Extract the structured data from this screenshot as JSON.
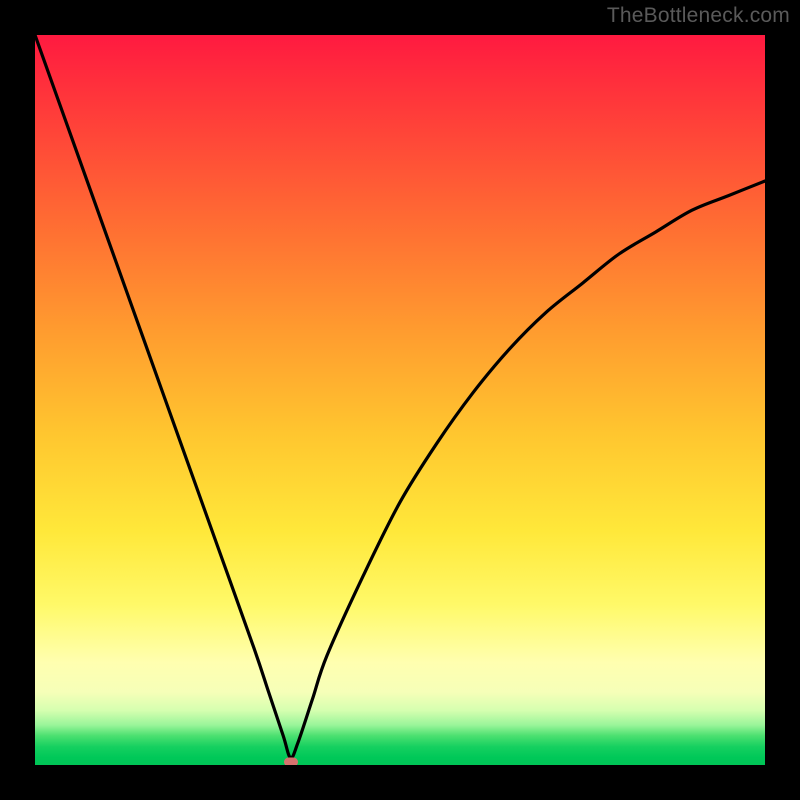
{
  "watermark": "TheBottleneck.com",
  "chart_data": {
    "type": "line",
    "title": "",
    "xlabel": "",
    "ylabel": "",
    "xlim": [
      0,
      100
    ],
    "ylim": [
      0,
      100
    ],
    "grid": false,
    "legend": false,
    "background": "red-yellow-green vertical gradient",
    "series": [
      {
        "name": "bottleneck-curve",
        "color": "#000000",
        "x": [
          0,
          5,
          10,
          15,
          20,
          25,
          30,
          32,
          34,
          35,
          36,
          38,
          40,
          45,
          50,
          55,
          60,
          65,
          70,
          75,
          80,
          85,
          90,
          95,
          100
        ],
        "values": [
          100,
          86,
          72,
          58,
          44,
          30,
          16,
          10,
          4,
          1,
          3,
          9,
          15,
          26,
          36,
          44,
          51,
          57,
          62,
          66,
          70,
          73,
          76,
          78,
          80
        ]
      }
    ],
    "marker": {
      "x": 35,
      "y": 0,
      "color": "#d6726e"
    },
    "gradient_stops": [
      {
        "pct": 0,
        "color": "#ff1a40"
      },
      {
        "pct": 10,
        "color": "#ff3a3a"
      },
      {
        "pct": 25,
        "color": "#ff6a33"
      },
      {
        "pct": 40,
        "color": "#ff9a2f"
      },
      {
        "pct": 55,
        "color": "#ffc72f"
      },
      {
        "pct": 68,
        "color": "#ffe83a"
      },
      {
        "pct": 78,
        "color": "#fff968"
      },
      {
        "pct": 86,
        "color": "#ffffb0"
      },
      {
        "pct": 90,
        "color": "#f6ffb8"
      },
      {
        "pct": 92.5,
        "color": "#d6ffb0"
      },
      {
        "pct": 94.5,
        "color": "#9bf59a"
      },
      {
        "pct": 96,
        "color": "#4be070"
      },
      {
        "pct": 97.5,
        "color": "#16d060"
      },
      {
        "pct": 99,
        "color": "#00c858"
      },
      {
        "pct": 100,
        "color": "#00c456"
      }
    ]
  }
}
